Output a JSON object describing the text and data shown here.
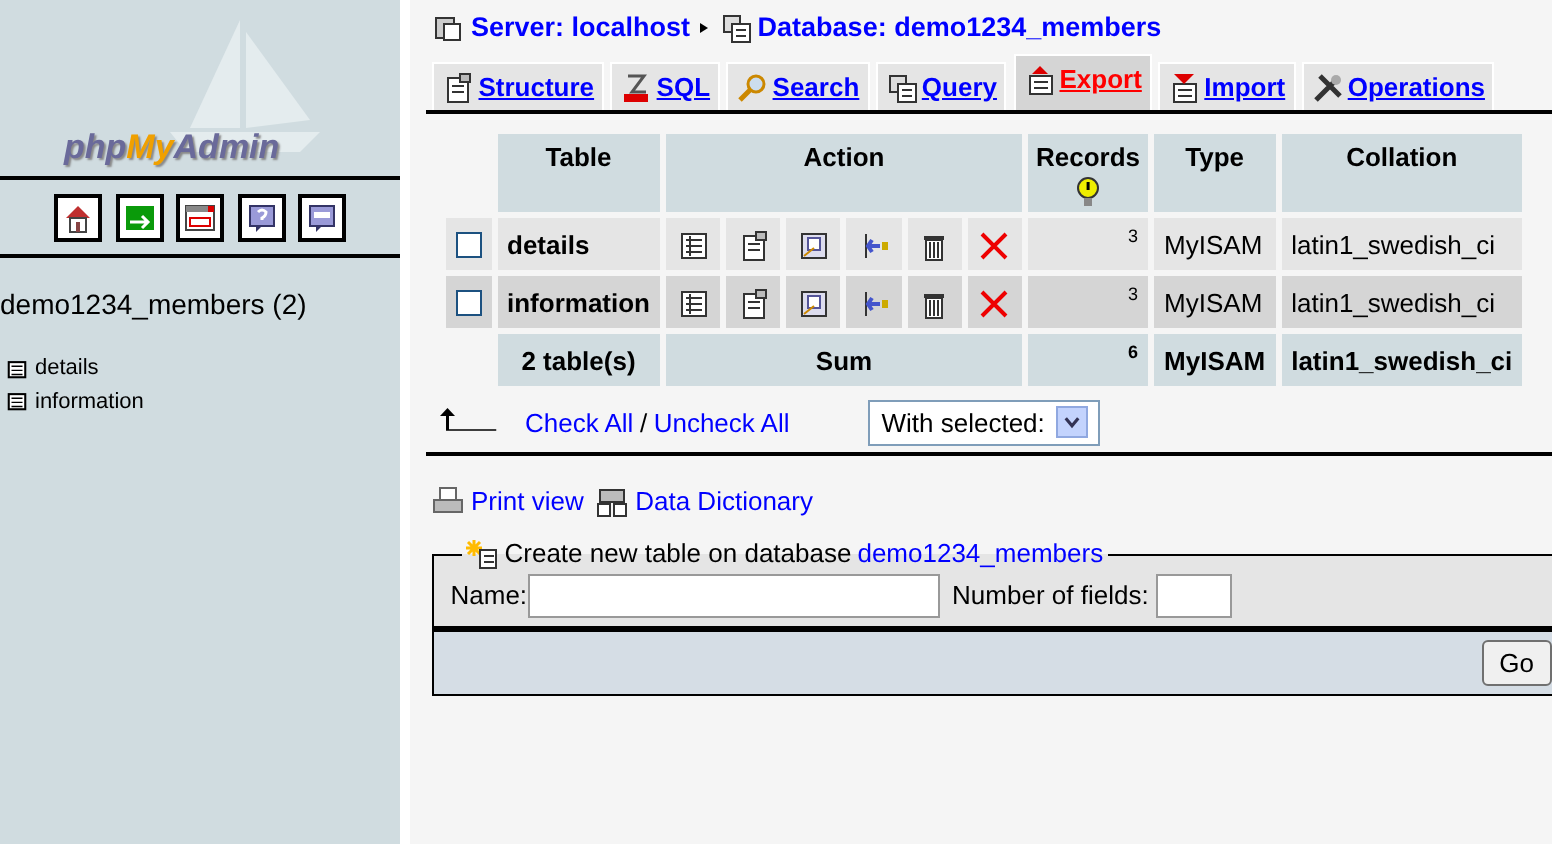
{
  "sidebar": {
    "logo": "phpMyAdmin",
    "database": "demo1234_members (2)",
    "tables": [
      "details",
      "information"
    ]
  },
  "breadcrumb": {
    "server": "Server: localhost",
    "database": "Database: demo1234_members"
  },
  "tabs": [
    {
      "label": "Structure",
      "selected": false
    },
    {
      "label": "SQL",
      "selected": false
    },
    {
      "label": "Search",
      "selected": false
    },
    {
      "label": "Query",
      "selected": false
    },
    {
      "label": "Export",
      "selected": true
    },
    {
      "label": "Import",
      "selected": false
    },
    {
      "label": "Operations",
      "selected": false
    }
  ],
  "table": {
    "columns": [
      "Table",
      "Action",
      "Records",
      "Type",
      "Collation"
    ],
    "rows": [
      {
        "checked": false,
        "name": "details",
        "records": "3",
        "type": "MyISAM",
        "collation": "latin1_swedish_ci"
      },
      {
        "checked": false,
        "name": "information",
        "records": "3",
        "type": "MyISAM",
        "collation": "latin1_swedish_ci"
      }
    ],
    "footer": {
      "count": "2 table(s)",
      "label": "Sum",
      "records": "6",
      "type": "MyISAM",
      "collation": "latin1_swedish_ci"
    }
  },
  "bulk": {
    "check_all": "Check All",
    "separator": "/",
    "uncheck_all": "Uncheck All",
    "with_selected": "With selected:"
  },
  "links": [
    "Print view",
    "Data Dictionary"
  ],
  "create": {
    "legend": "Create new table on database",
    "database": "demo1234_members",
    "name_label": "Name:",
    "fields_label": "Number of fields:",
    "go": "Go"
  }
}
